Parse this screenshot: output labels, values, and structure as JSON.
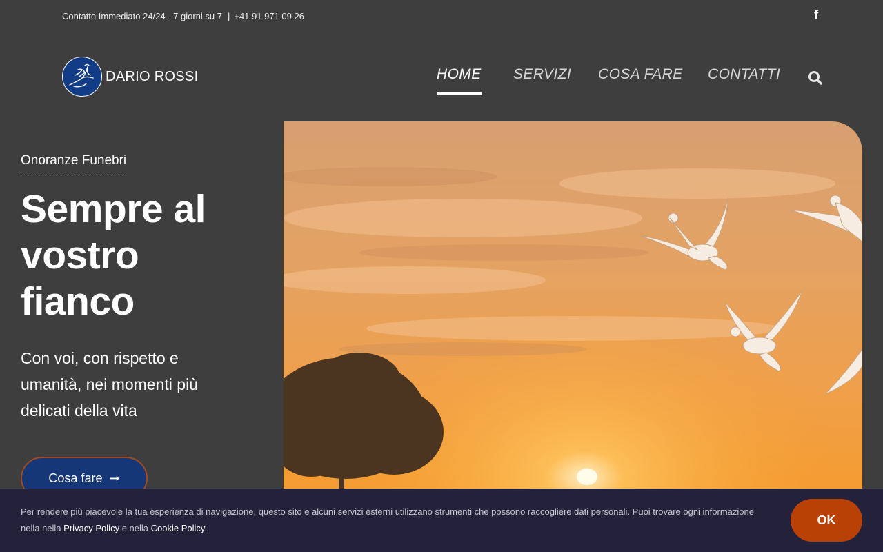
{
  "topbar": {
    "contact_text": "Contatto Immediato 24/24 - 7 giorni su 7",
    "separator": "|",
    "phone": "+41 91 971 09 26",
    "social_icon": "facebook-icon",
    "social_glyph": "f"
  },
  "brand": {
    "name": "DARIO ROSSI",
    "logo_icon": "dove-icon",
    "logo_color": "#123c86"
  },
  "nav": {
    "items": [
      {
        "label": "HOME",
        "active": true
      },
      {
        "label": "SERVIZI",
        "active": false
      },
      {
        "label": "COSA FARE",
        "active": false
      },
      {
        "label": "CONTATTI",
        "active": false
      }
    ],
    "search_icon": "search-icon"
  },
  "hero": {
    "eyebrow": "Onoranze Funebri",
    "headline": "Sempre al vostro fianco",
    "subheadline": "Con voi, con rispetto e umanità, nei momenti più delicati della vita",
    "cta_label": "Cosa fare",
    "cta_icon": "arrow-right-icon",
    "cta_arrow": "➞",
    "image": "sunset-doves-tree-image"
  },
  "cookie": {
    "text_before": "Per rendere più piacevole la tua esperienza di navigazione, questo sito e alcuni servizi esterni utilizzano strumenti che possono raccogliere dati personali. Puoi trovare ogni informazione nella nella ",
    "privacy_link": "Privacy Policy",
    "text_middle": " e nella ",
    "cookie_link": "Cookie Policy",
    "text_after": ".",
    "ok_label": "OK"
  },
  "colors": {
    "background": "#3e3e3f",
    "accent_orange": "#b94106",
    "button_blue": "#163777",
    "cookie_bg": "#24223b"
  }
}
